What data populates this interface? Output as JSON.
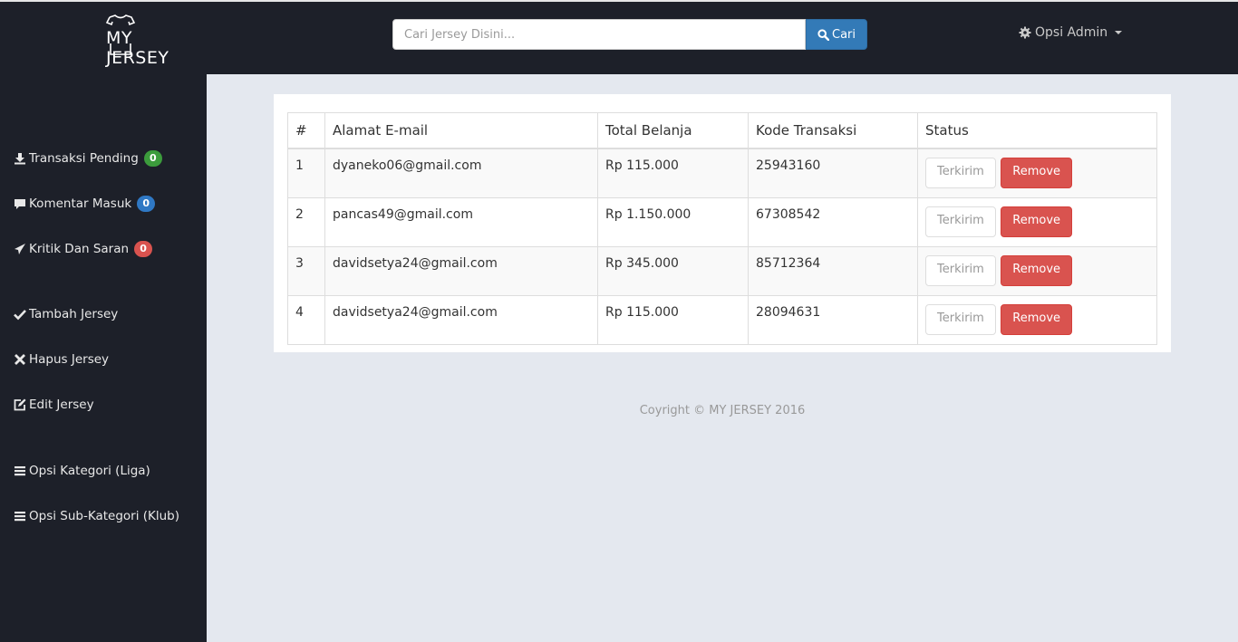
{
  "header": {
    "logo_text": "MY JERSEY",
    "search": {
      "placeholder": "Cari Jersey Disini...",
      "button_label": "Cari"
    },
    "admin_menu_label": "Opsi Admin"
  },
  "sidebar": {
    "items": [
      {
        "label": "Transaksi Pending",
        "icon": "download-icon",
        "badge": "0",
        "badge_color": "#3c9c3c"
      },
      {
        "label": "Komentar Masuk",
        "icon": "comment-icon",
        "badge": "0",
        "badge_color": "#2f78c4"
      },
      {
        "label": "Kritik Dan Saran",
        "icon": "paper-plane-icon",
        "badge": "0",
        "badge_color": "#d9534f"
      },
      {
        "label": "Tambah Jersey",
        "icon": "check-icon"
      },
      {
        "label": "Hapus Jersey",
        "icon": "times-icon"
      },
      {
        "label": "Edit Jersey",
        "icon": "edit-icon"
      },
      {
        "label": "Opsi Kategori (Liga)",
        "icon": "list-icon"
      },
      {
        "label": "Opsi Sub-Kategori (Klub)",
        "icon": "list-icon"
      }
    ]
  },
  "table": {
    "headers": [
      "#",
      "Alamat E-mail",
      "Total Belanja",
      "Kode Transaksi",
      "Status"
    ],
    "rows": [
      {
        "no": "1",
        "email": "dyaneko06@gmail.com",
        "total": "Rp 115.000",
        "kode": "25943160"
      },
      {
        "no": "2",
        "email": "pancas49@gmail.com",
        "total": "Rp 1.150.000",
        "kode": "67308542"
      },
      {
        "no": "3",
        "email": "davidsetya24@gmail.com",
        "total": "Rp 345.000",
        "kode": "85712364"
      },
      {
        "no": "4",
        "email": "davidsetya24@gmail.com",
        "total": "Rp 115.000",
        "kode": "28094631"
      }
    ],
    "status_button_label": "Terkirim",
    "remove_button_label": "Remove"
  },
  "footer": {
    "copyright": "Coyright © MY JERSEY 2016"
  }
}
